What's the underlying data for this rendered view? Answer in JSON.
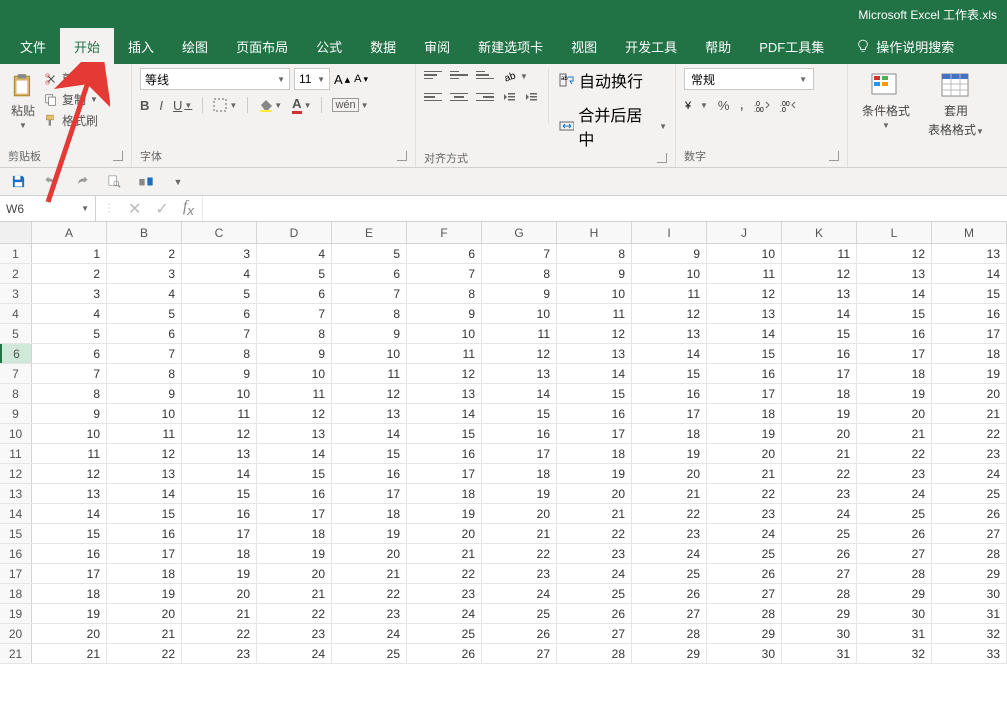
{
  "title": "Microsoft Excel 工作表.xls",
  "tabs": [
    "文件",
    "开始",
    "插入",
    "绘图",
    "页面布局",
    "公式",
    "数据",
    "审阅",
    "新建选项卡",
    "视图",
    "开发工具",
    "帮助",
    "PDF工具集"
  ],
  "active_tab_index": 1,
  "tell_me": "操作说明搜索",
  "clipboard": {
    "paste": "粘贴",
    "cut": "剪切",
    "copy": "复制",
    "format_painter": "格式刷",
    "label": "剪贴板"
  },
  "font": {
    "name": "等线",
    "size": "11",
    "bold": "B",
    "italic": "I",
    "underline": "U",
    "label": "字体"
  },
  "alignment": {
    "wrap": "自动换行",
    "merge": "合并后居中",
    "label": "对齐方式"
  },
  "number": {
    "format": "常规",
    "label": "数字"
  },
  "styles": {
    "cond_fmt": "条件格式",
    "table_fmt_1": "套用",
    "table_fmt_2": "表格格式"
  },
  "qat": {
    "save": "save",
    "undo": "undo",
    "redo": "redo"
  },
  "name_box": "W6",
  "columns": [
    "A",
    "B",
    "C",
    "D",
    "E",
    "F",
    "G",
    "H",
    "I",
    "J",
    "K",
    "L",
    "M"
  ],
  "row_count": 21,
  "selected_row": 6,
  "chart_data": {
    "type": "table",
    "note": "cell(r,c) = r + c - 1 for 1-indexed row r and column c; grid shows rows 1-21 and columns A-M (1-13)",
    "rows": 21,
    "cols": 13
  }
}
